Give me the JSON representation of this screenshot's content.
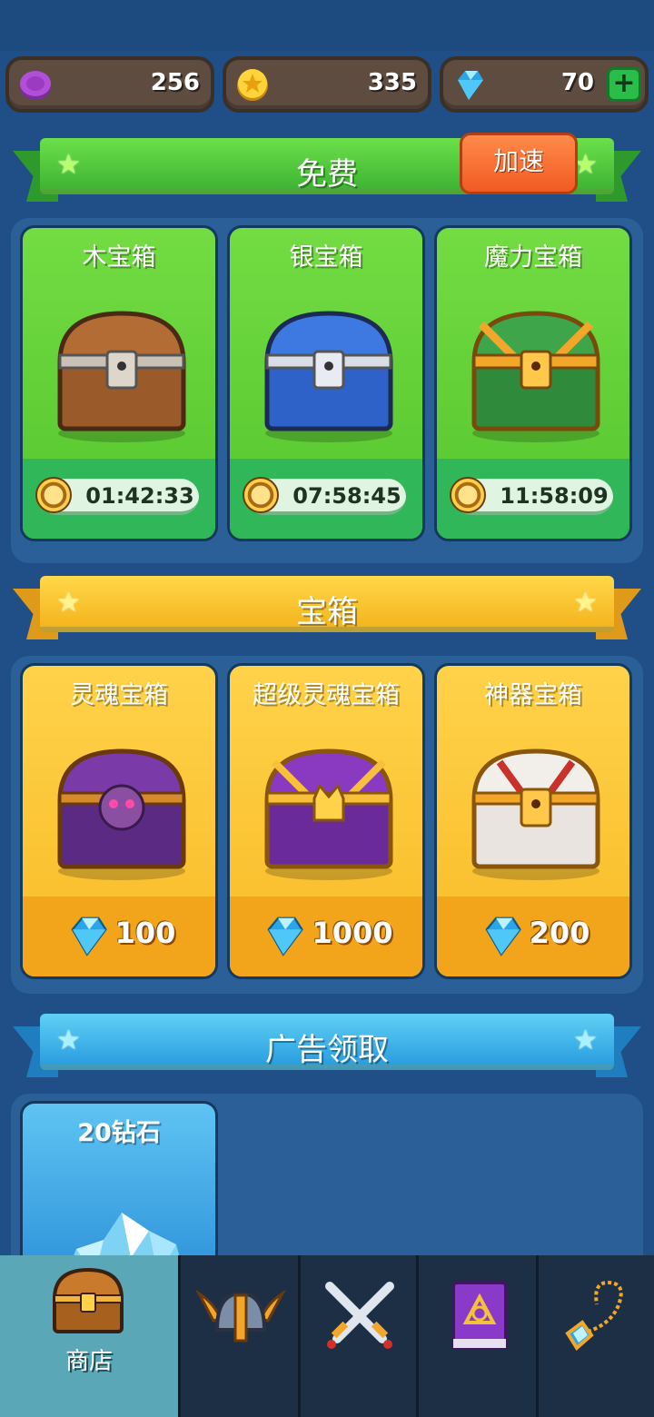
{
  "currency": {
    "soul": {
      "value": "256",
      "icon": "purple-soul-coin-icon"
    },
    "gold": {
      "value": "335",
      "icon": "gold-coin-icon"
    },
    "gem": {
      "value": "70",
      "icon": "diamond-gem-icon",
      "add": "+"
    }
  },
  "free_section": {
    "title": "免费",
    "speed_button": "加速",
    "chests": [
      {
        "name": "木宝箱",
        "timer": "01:42:33"
      },
      {
        "name": "银宝箱",
        "timer": "07:58:45"
      },
      {
        "name": "魔力宝箱",
        "timer": "11:58:09"
      }
    ]
  },
  "chest_section": {
    "title": "宝箱",
    "chests": [
      {
        "name": "灵魂宝箱",
        "price": "100"
      },
      {
        "name": "超级灵魂宝箱",
        "price": "1000"
      },
      {
        "name": "神器宝箱",
        "price": "200"
      }
    ]
  },
  "ad_section": {
    "title": "广告领取",
    "items": [
      {
        "name": "20钻石"
      }
    ]
  },
  "nav": {
    "tabs": [
      {
        "label": "商店",
        "icon": "shop-chest-icon",
        "active": true
      },
      {
        "label": "",
        "icon": "winged-helmet-icon"
      },
      {
        "label": "",
        "icon": "crossed-swords-icon"
      },
      {
        "label": "",
        "icon": "spellbook-icon"
      },
      {
        "label": "",
        "icon": "amulet-icon"
      }
    ]
  },
  "colors": {
    "background": "#1f4f86",
    "free_banner": "#4fc63a",
    "chest_banner": "#f8c22a",
    "ad_banner": "#3fb3ea",
    "nav_active": "#5aa7b8"
  }
}
